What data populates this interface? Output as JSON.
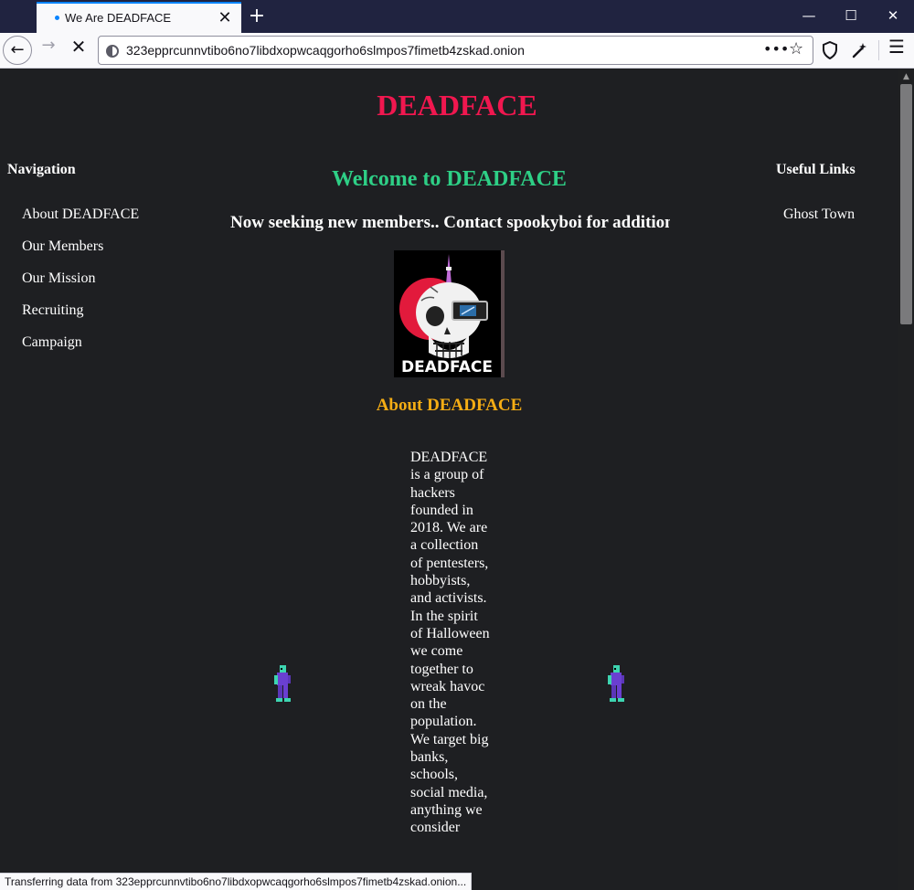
{
  "browser": {
    "tab_title": "We Are DEADFACE",
    "url": "323epprcunnvtibo6no7libdxopwcaqgorho6slmpos7fimetb4zskad.onion",
    "status_text": "Transferring data from 323epprcunnvtibo6no7libdxopwcaqgorho6slmpos7fimetb4zskad.onion..."
  },
  "site": {
    "title": "DEADFACE",
    "welcome": "Welcome to DEADFACE",
    "announcement": "Now seeking new members.. Contact spookyboi for additional",
    "logo_text": "DEADFACE"
  },
  "navigation": {
    "heading": "Navigation",
    "items": [
      "About DEADFACE",
      "Our Members",
      "Our Mission",
      "Recruiting",
      "Campaign"
    ]
  },
  "useful_links": {
    "heading": "Useful Links",
    "items": [
      "Ghost Town"
    ]
  },
  "about": {
    "heading": "About DEADFACE",
    "text": "DEADFACE is a group of hackers founded in 2018. We are a collection of pentesters, hobbyists, and activists. In the spirit of Halloween we come together to wreak havoc on the population. We target big banks, schools, social media, anything we consider"
  },
  "colors": {
    "page_bg": "#1e1f22",
    "site_title": "#f0174f",
    "welcome": "#2ecf86",
    "about_heading": "#f5ad14",
    "text": "#ffffff"
  }
}
